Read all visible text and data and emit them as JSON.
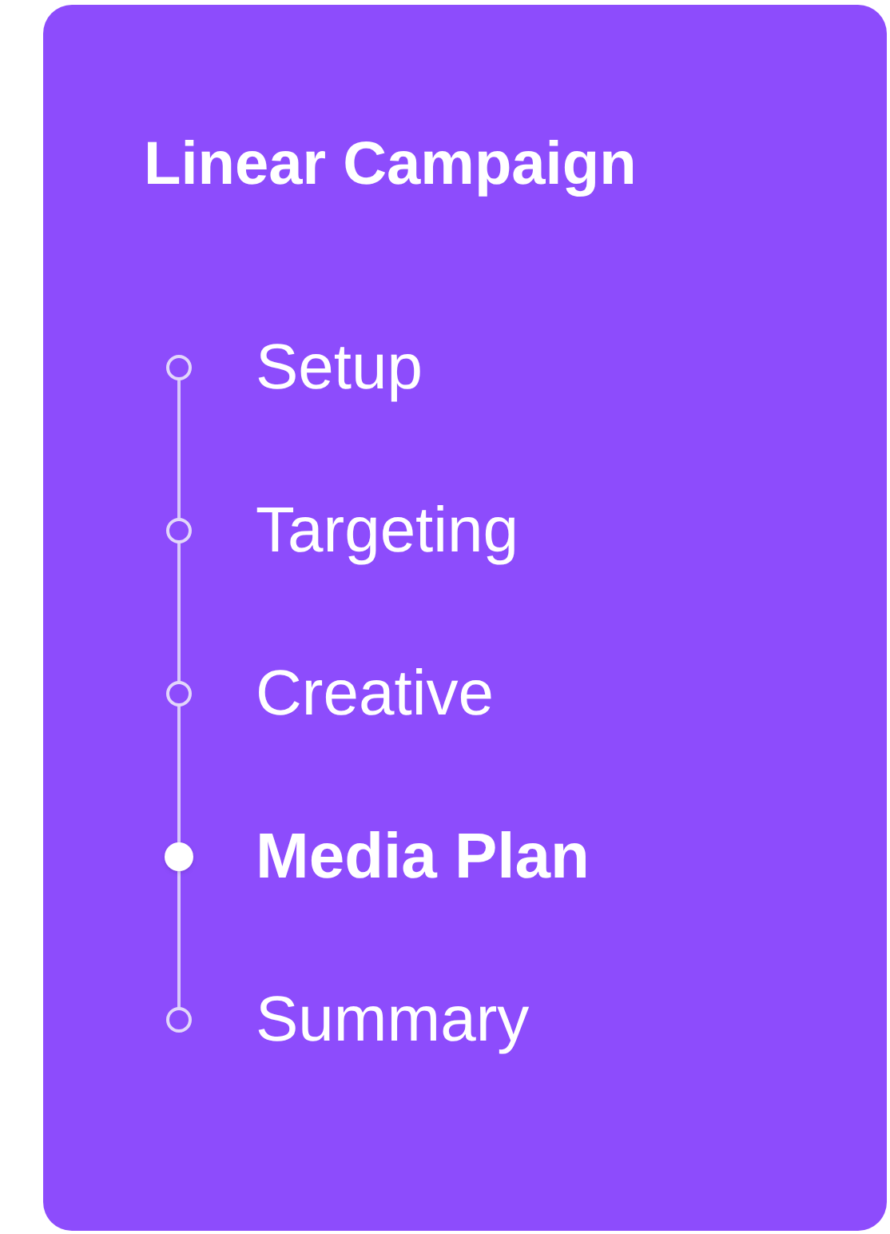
{
  "title": "Linear Campaign",
  "steps": [
    {
      "label": "Setup",
      "selected": false
    },
    {
      "label": "Targeting",
      "selected": false
    },
    {
      "label": "Creative",
      "selected": false
    },
    {
      "label": "Media Plan",
      "selected": true
    },
    {
      "label": "Summary",
      "selected": false
    }
  ]
}
